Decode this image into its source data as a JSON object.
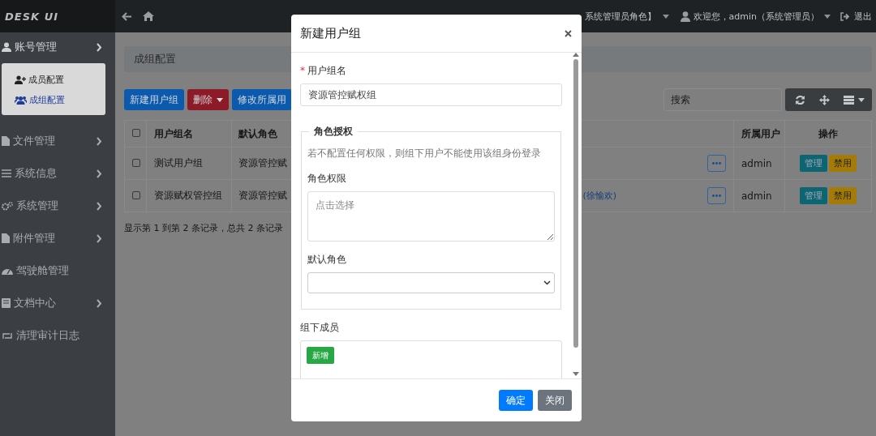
{
  "topbar": {
    "brand": "DESK UI",
    "role_switch": "系统管理员角色】",
    "welcome": "欢迎您，admin（系统管理员）",
    "logout": "退出"
  },
  "sidebar": {
    "items": [
      {
        "label": "账号管理",
        "expandable": true,
        "expanded": true,
        "children": [
          {
            "label": "成员配置",
            "selected": false
          },
          {
            "label": "成组配置",
            "selected": true
          }
        ]
      },
      {
        "label": "文件管理",
        "expandable": true,
        "expanded": false
      },
      {
        "label": "系统信息",
        "expandable": true,
        "expanded": false
      },
      {
        "label": "系统管理",
        "expandable": true,
        "expanded": false
      },
      {
        "label": "附件管理",
        "expandable": true,
        "expanded": false
      },
      {
        "label": "驾驶舱管理",
        "expandable": false,
        "expanded": false
      },
      {
        "label": "文档中心",
        "expandable": true,
        "expanded": false
      },
      {
        "label": "清理审计日志",
        "expandable": false,
        "expanded": false
      }
    ]
  },
  "breadcrumb": "成组配置",
  "toolbar": {
    "buttons": [
      {
        "label": "新建用户组",
        "kind": "primary",
        "dropdown": false
      },
      {
        "label": "删除",
        "kind": "danger",
        "dropdown": true
      },
      {
        "label": "修改所属用",
        "kind": "primary",
        "dropdown": false
      }
    ],
    "search": {
      "placeholder": "搜索"
    }
  },
  "table": {
    "header_checked": false,
    "columns": [
      "用户组名",
      "默认角色",
      "所属用户",
      "操作"
    ],
    "rows": [
      {
        "checked": false,
        "name": "测试用户组",
        "default_role": "资源管控赋",
        "members": "",
        "owner": "admin",
        "actions": [
          {
            "label": "管理",
            "kind": "info"
          },
          {
            "label": "禁用",
            "kind": "warning"
          }
        ]
      },
      {
        "checked": false,
        "name": "资源赋权管控组",
        "default_role": "资源管控赋",
        "members": "(徐愉欢)",
        "owner": "admin",
        "actions": [
          {
            "label": "管理",
            "kind": "info"
          },
          {
            "label": "禁用",
            "kind": "warning"
          }
        ]
      }
    ],
    "footer": "显示第 1 到第 2 条记录，总共 2 条记录"
  },
  "modal": {
    "title": "新建用户组",
    "name_field": {
      "required_mark": "*",
      "label": "用户组名",
      "value": "资源管控赋权组"
    },
    "fieldset": {
      "legend": "角色授权",
      "hint": "若不配置任何权限，则组下用户不能使用该组身份登录",
      "permission": {
        "label": "角色权限",
        "placeholder": "点击选择"
      },
      "default_role": {
        "label": "默认角色"
      }
    },
    "members": {
      "label": "组下成员",
      "add_button": "新增"
    },
    "buttons": [
      {
        "label": "确定",
        "kind": "primary"
      },
      {
        "label": "关闭",
        "kind": "secondary"
      }
    ]
  }
}
